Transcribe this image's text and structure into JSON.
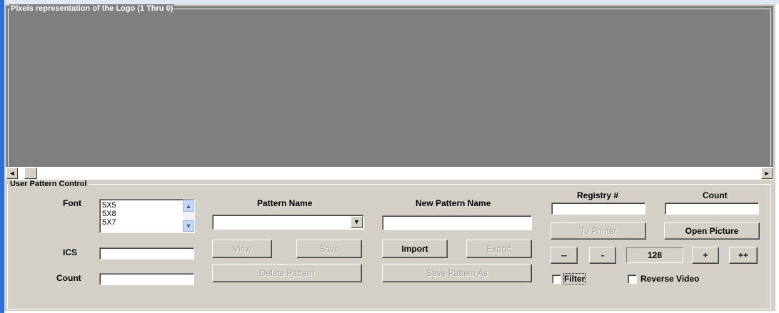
{
  "pixels_panel": {
    "legend": "Pixels representation of the Logo (1 Thru 0)"
  },
  "scrollbar": {
    "left_arrow": "◄",
    "right_arrow": "►"
  },
  "user_pattern": {
    "legend": "User Pattern Control",
    "font_label": "Font",
    "font_options": [
      "5X5",
      "5X8",
      "5X7"
    ],
    "ics_label": "ICS",
    "ics_value": "",
    "count_label": "Count",
    "count_value": "",
    "pattern_name_label": "Pattern Name",
    "pattern_name_value": "",
    "new_pattern_name_label": "New Pattern Name",
    "new_pattern_name_value": "",
    "registry_label": "Registry #",
    "registry_value": "",
    "count2_label": "Count",
    "count2_value": "",
    "buttons": {
      "view": "View",
      "save": "Save",
      "import": "Import",
      "export": "Export",
      "delete_pattern": "Delete Pattern",
      "save_pattern_as": "Save Pattern As",
      "to_printer": "To Printer",
      "open_picture": "Open Picture",
      "dec_big": "--",
      "dec": "-",
      "inc": "+",
      "inc_big": "++"
    },
    "threshold_value": "128",
    "filter_label": "Filter",
    "reverse_video_label": "Reverse Video"
  },
  "colors": {
    "pixel_area": "#7f7f7f",
    "window_face": "#d4d0c8",
    "accent_edge": "#2f6fd0"
  }
}
